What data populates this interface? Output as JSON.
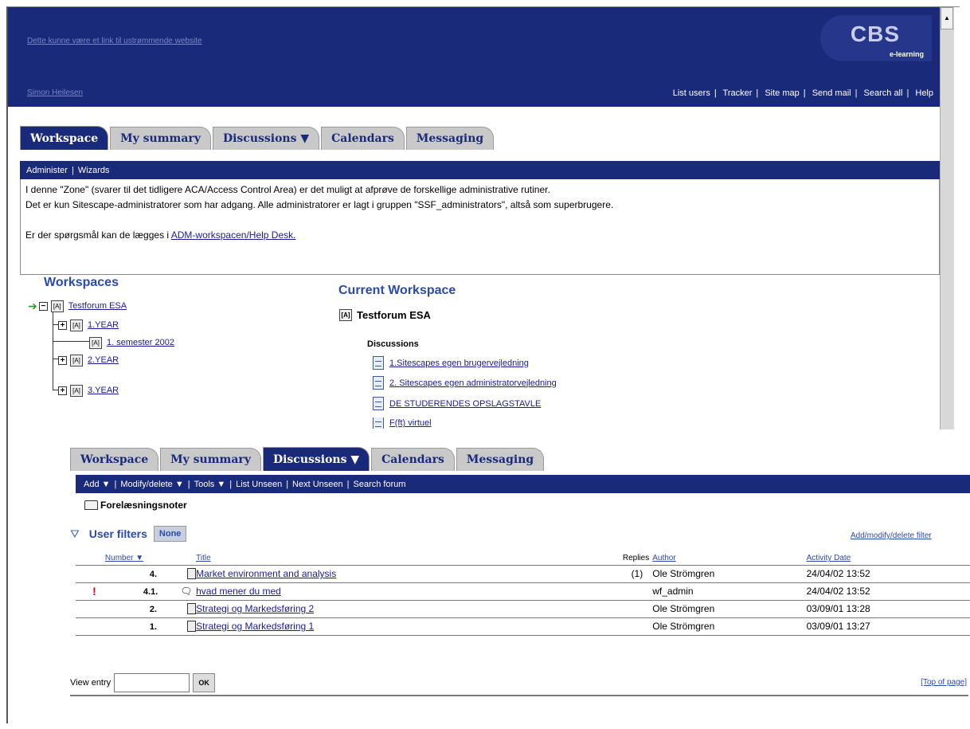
{
  "header": {
    "top_link": "Dette kunne være et link til ustrømmende website",
    "user_link": "Simon Heilesen",
    "logo_text": "CBS",
    "logo_sub": "e-learning",
    "links": [
      "List users",
      "Tracker",
      "Site map",
      "Send mail",
      "Search all",
      "Help"
    ]
  },
  "tabs1": [
    "Workspace",
    "My summary",
    "Discussions ▼",
    "Calendars",
    "Messaging"
  ],
  "subbar1": [
    "Administer",
    "Wizards"
  ],
  "intro": {
    "line1": "I denne \"Zone\" (svarer til det tidligere ACA/Access Control Area) er det muligt at afprøve de forskellige administrative rutiner.",
    "line2": "Det er kun Sitescape-administratorer som har adgang. Alle administratorer er lagt i gruppen \"SSF_administrators\", altså som superbrugere.",
    "line3_prefix": "Er der spørgsmål kan de lægges i ",
    "line3_link": "ADM-workspacen/Help Desk."
  },
  "workspaces": {
    "title": "Workspaces",
    "items": [
      "Testforum ESA",
      "1.YEAR",
      "1. semester 2002",
      "2.YEAR",
      "3.YEAR"
    ]
  },
  "current": {
    "title": "Current Workspace",
    "name": "Testforum ESA",
    "disc_label": "Discussions",
    "discussions": [
      "1.Sitescapes egen brugervejledning",
      "2. Sitescapes egen administratorvejledning",
      "DE STUDERENDES OPSLAGSTAVLE",
      "F(ft) virtuel"
    ]
  },
  "tabs2": [
    "Workspace",
    "My summary",
    "Discussions ▼",
    "Calendars",
    "Messaging"
  ],
  "subbar2": [
    "Add ▼",
    "Modify/delete ▼",
    "Tools ▼",
    "List Unseen",
    "Next Unseen",
    "Search forum"
  ],
  "forum": {
    "name": "Forelæsningsnoter",
    "filters_label": "User filters",
    "filters_value": "None",
    "filters_link": "Add/modify/delete filter"
  },
  "table": {
    "headers": {
      "number": "Number ▼",
      "title": "Title",
      "replies": "Replies",
      "author": "Author",
      "date": "Activity Date"
    },
    "rows": [
      {
        "flag": "",
        "number": "4.",
        "type": "doc",
        "title": "Market environment and analysis",
        "replies": "(1)",
        "author": "Ole Strömgren",
        "date": "24/04/02 13:52"
      },
      {
        "flag": "!",
        "number": "4.1.",
        "type": "reply",
        "title": "hvad mener du med",
        "replies": "",
        "author": "wf_admin",
        "date": "24/04/02 13:52"
      },
      {
        "flag": "",
        "number": "2.",
        "type": "doc",
        "title": "Strategi og Markedsføring 2",
        "replies": "",
        "author": "Ole Strömgren",
        "date": "03/09/01 13:28"
      },
      {
        "flag": "",
        "number": "1.",
        "type": "doc",
        "title": "Strategi og Markedsføring 1",
        "replies": "",
        "author": "Ole Strömgren",
        "date": "03/09/01 13:27"
      }
    ]
  },
  "view_entry": {
    "label": "View entry",
    "ok": "OK",
    "top_of_page": "[Top of page]"
  }
}
